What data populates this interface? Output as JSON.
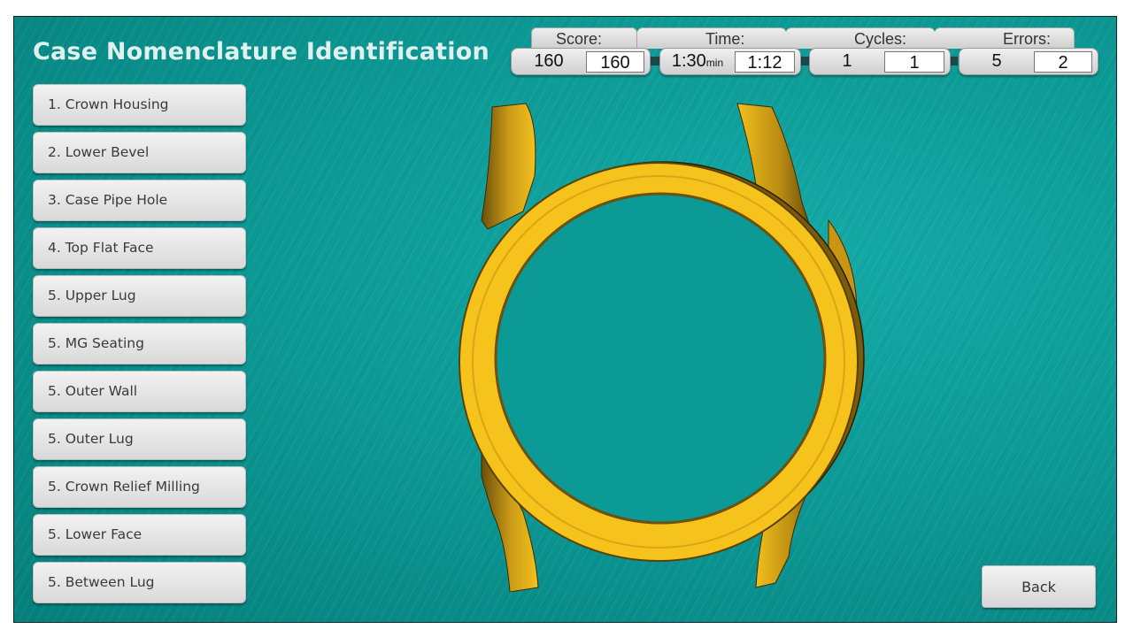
{
  "header": {
    "title": "Case Nomenclature Identification"
  },
  "stats": {
    "score": {
      "label": "Score:",
      "target": "160",
      "current": "160"
    },
    "time": {
      "label": "Time:",
      "target": "1:30",
      "unit": "min",
      "current": "1:12"
    },
    "cycles": {
      "label": "Cycles:",
      "target": "1",
      "current": "1"
    },
    "errors": {
      "label": "Errors:",
      "target": "5",
      "current": "2"
    }
  },
  "parts": [
    {
      "label": "1. Crown Housing"
    },
    {
      "label": "2. Lower Bevel"
    },
    {
      "label": "3. Case Pipe Hole"
    },
    {
      "label": "4. Top Flat Face"
    },
    {
      "label": "5. Upper Lug"
    },
    {
      "label": "5. MG Seating"
    },
    {
      "label": "5. Outer Wall"
    },
    {
      "label": "5. Outer Lug"
    },
    {
      "label": "5. Crown Relief Milling"
    },
    {
      "label": "5. Lower Face"
    },
    {
      "label": "5. Between Lug"
    }
  ],
  "footer": {
    "back_label": "Back"
  },
  "colors": {
    "background": "#0c9a96",
    "title": "#dff1ee",
    "watch_case": "#f6c21c",
    "watch_shadow": "#7a5a0c"
  }
}
